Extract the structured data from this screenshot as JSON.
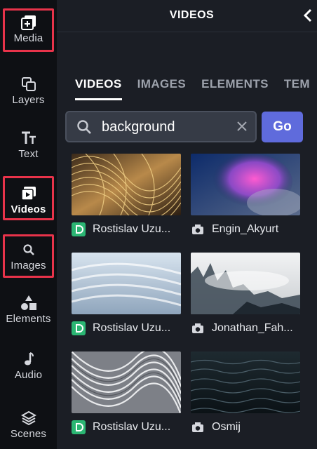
{
  "rail": {
    "items": [
      {
        "label": "Media",
        "icon": "media-plus-icon"
      },
      {
        "label": "Layers",
        "icon": "layers-icon"
      },
      {
        "label": "Text",
        "icon": "text-icon"
      },
      {
        "label": "Videos",
        "icon": "video-icon"
      },
      {
        "label": "Images",
        "icon": "search-image-icon"
      },
      {
        "label": "Elements",
        "icon": "shapes-icon"
      },
      {
        "label": "Audio",
        "icon": "music-note-icon"
      },
      {
        "label": "Scenes",
        "icon": "stack-icon"
      }
    ],
    "active": "Videos",
    "highlight_color": "#e8334a"
  },
  "panel": {
    "title": "VIDEOS",
    "tabs": [
      "VIDEOS",
      "IMAGES",
      "ELEMENTS",
      "TEM"
    ],
    "active_tab": "VIDEOS"
  },
  "search": {
    "value": "background",
    "go_label": "Go",
    "accent": "#5f6bdc"
  },
  "results": [
    {
      "author": "Rostislav Uzu...",
      "source_icon": "green-badge-icon",
      "thumb": "golden-waves"
    },
    {
      "author": "Engin_Akyurt",
      "source_icon": "camera-icon",
      "thumb": "pink-smoke"
    },
    {
      "author": "Rostislav Uzu...",
      "source_icon": "green-badge-icon",
      "thumb": "white-waves"
    },
    {
      "author": "Jonathan_Fah...",
      "source_icon": "camera-icon",
      "thumb": "misty-forest"
    },
    {
      "author": "Rostislav Uzu...",
      "source_icon": "green-badge-icon",
      "thumb": "silver-ribbons"
    },
    {
      "author": "Osmij",
      "source_icon": "camera-icon",
      "thumb": "dark-sea"
    }
  ]
}
